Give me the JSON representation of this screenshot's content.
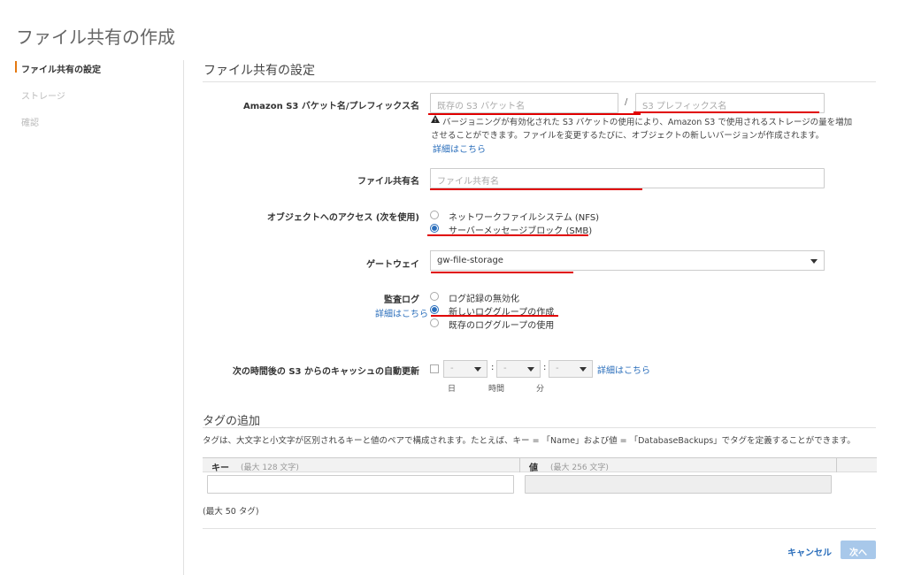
{
  "page_title": "ファイル共有の作成",
  "nav": [
    {
      "label": "ファイル共有の設定"
    },
    {
      "label": "ストレージ"
    },
    {
      "label": "確認"
    }
  ],
  "section_title": "ファイル共有の設定",
  "bucket": {
    "label": "Amazon S3 バケット名/プレフィックス名",
    "bucket_placeholder": "既存の S3 バケット名",
    "separator": "/",
    "prefix_placeholder": "S3 プレフィックス名",
    "warning_line1": "バージョニングが有効化された S3 バケットの使用により、Amazon S3 で使用されるストレージの量を増加",
    "warning_line2": "させることができます。ファイルを変更するたびに、オブジェクトの新しいバージョンが作成されます。",
    "details_link": "詳細はこちら"
  },
  "share_name": {
    "label": "ファイル共有名",
    "placeholder": "ファイル共有名"
  },
  "access": {
    "label": "オブジェクトへのアクセス (次を使用)",
    "options": [
      {
        "label": "ネットワークファイルシステム (NFS)",
        "selected": false
      },
      {
        "label": "サーバーメッセージブロック (SMB)",
        "selected": true
      }
    ]
  },
  "gateway": {
    "label": "ゲートウェイ",
    "value": "gw-file-storage"
  },
  "audit_log": {
    "label": "監査ログ",
    "details_link": "詳細はこちら",
    "options": [
      {
        "label": "ログ記録の無効化",
        "selected": false
      },
      {
        "label": "新しいロググループの作成",
        "selected": true
      },
      {
        "label": "既存のロググループの使用",
        "selected": false
      }
    ]
  },
  "cache_refresh": {
    "label": "次の時間後の S3 からのキャッシュの自動更新",
    "day_value": "-",
    "hour_value": "-",
    "minute_value": "-",
    "colon": ":",
    "day_label": "日",
    "hour_label": "時間",
    "minute_label": "分",
    "details_link": "詳細はこちら"
  },
  "tags": {
    "title": "タグの追加",
    "description": "タグは、大文字と小文字が区別されるキーと値のペアで構成されます。たとえば、キー = 「Name」および値 = 「DatabaseBackups」でタグを定義することができます。",
    "key_header": "キー",
    "key_hint": "(最大 128 文字)",
    "value_header": "値",
    "value_hint": "(最大 256 文字)",
    "max_note": "(最大 50 タグ)"
  },
  "buttons": {
    "cancel": "キャンセル",
    "next": "次へ"
  },
  "colors": {
    "accent": "#e47911",
    "link": "#2a6ebb",
    "annotation": "#e00000"
  }
}
